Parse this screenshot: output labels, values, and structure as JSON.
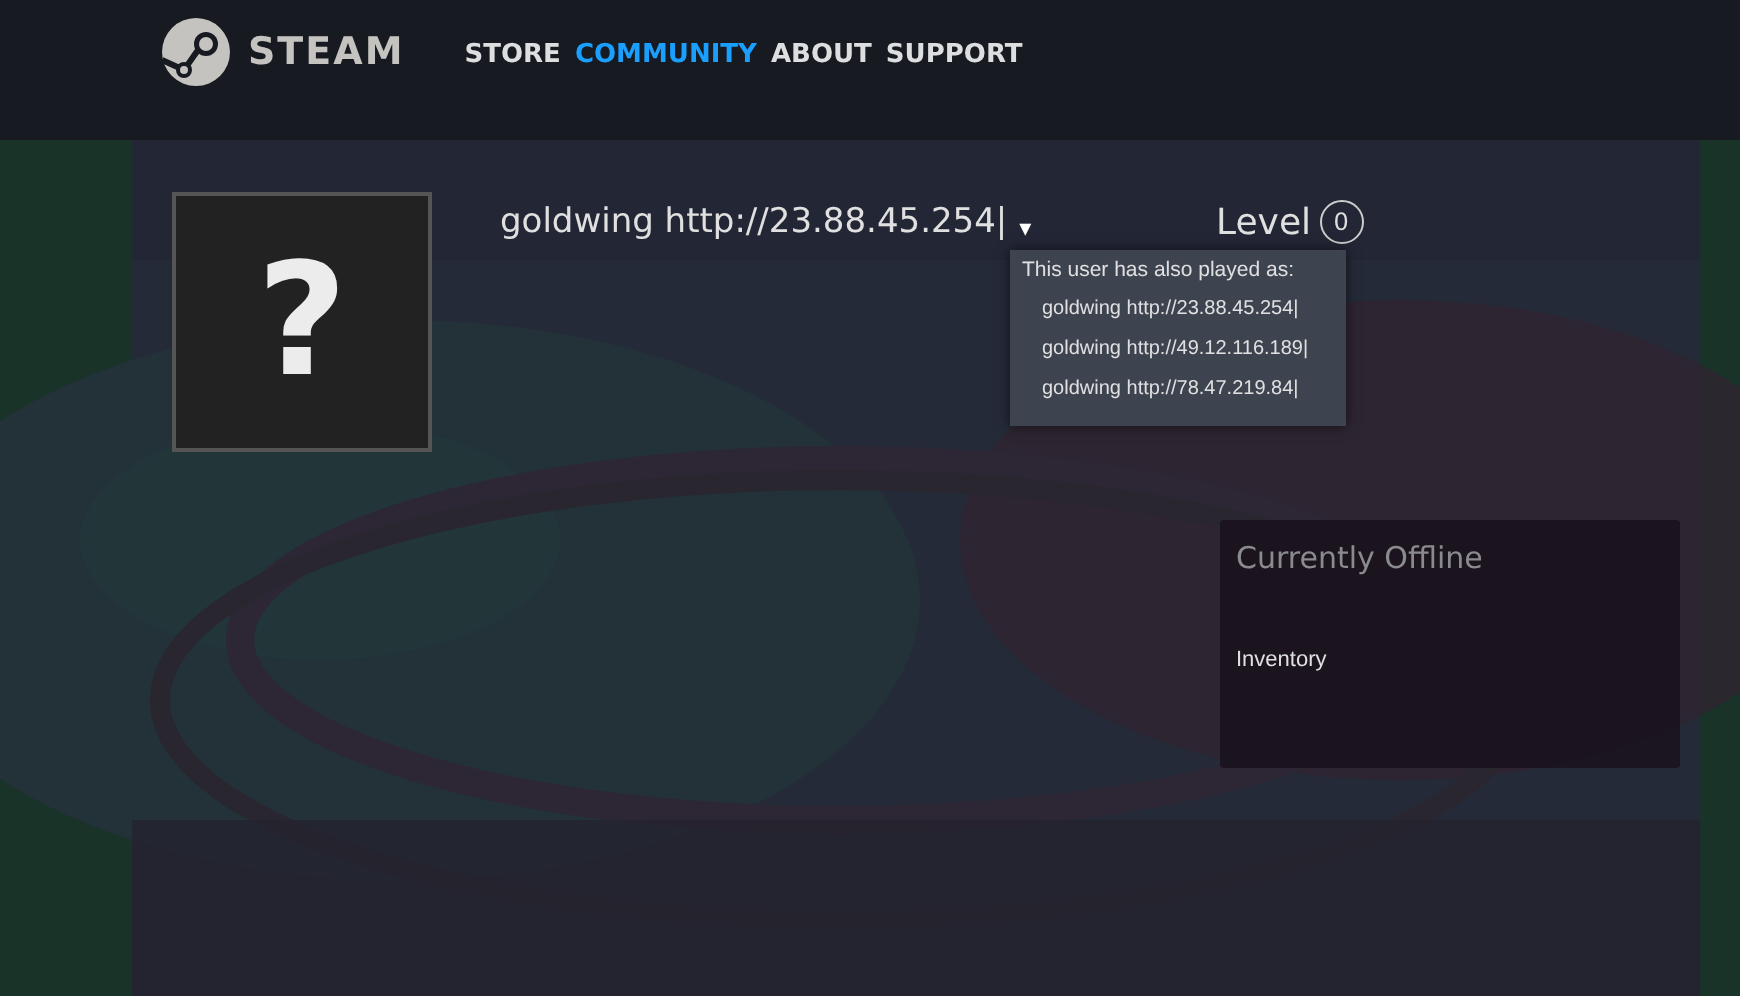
{
  "header": {
    "logo_text": "STEAM",
    "nav": [
      {
        "label": "STORE",
        "selected": false
      },
      {
        "label": "COMMUNITY",
        "selected": true
      },
      {
        "label": "ABOUT",
        "selected": false
      },
      {
        "label": "SUPPORT",
        "selected": false
      }
    ]
  },
  "profile": {
    "avatar_glyph": "?",
    "name": "goldwing http://23.88.45.254|",
    "dropdown_caret": "▾",
    "level_label": "Level",
    "level": "0"
  },
  "aliases_popup": {
    "title": "This user has also played as:",
    "items": [
      "goldwing http://23.88.45.254|",
      "goldwing http://49.12.116.189|",
      "goldwing http://78.47.219.84|"
    ]
  },
  "status_panel": {
    "status": "Currently Offline",
    "links": [
      "Inventory"
    ]
  }
}
